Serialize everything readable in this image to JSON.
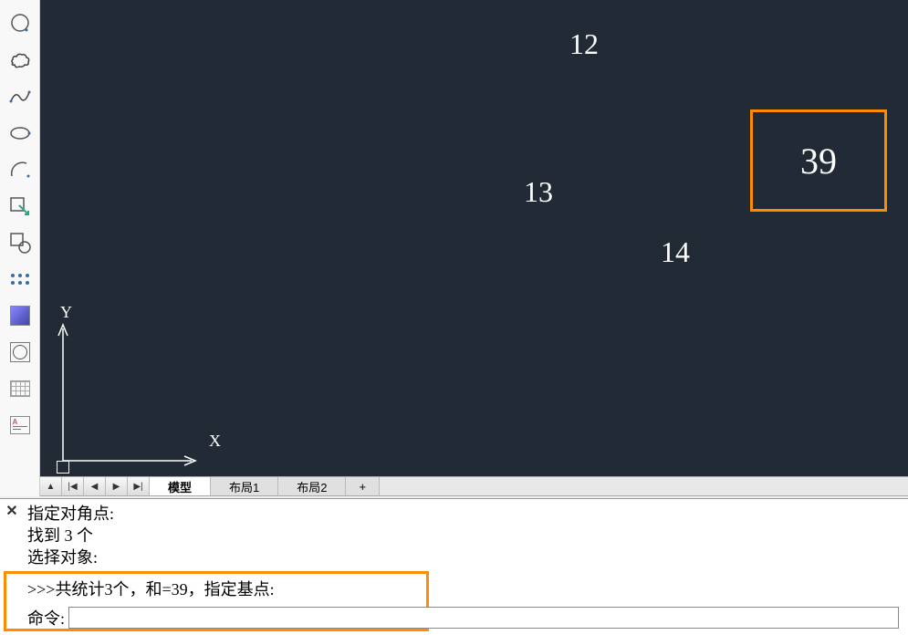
{
  "toolbar": {
    "items": [
      "circle-tool",
      "cloud-tool",
      "spline-tool",
      "ellipse-tool",
      "arc-tool",
      "block-insert-tool",
      "rect-circle-tool",
      "points-tool",
      "gradient-tool",
      "box-circle-tool",
      "grid-tool",
      "text-tool"
    ]
  },
  "canvas": {
    "numbers": {
      "n1": "12",
      "n2": "13",
      "n3": "14"
    },
    "highlight_value": "39",
    "ucs": {
      "x_label": "X",
      "y_label": "Y"
    }
  },
  "tabs": {
    "nav": {
      "first": "▲",
      "prev_all": "|◀",
      "prev": "◀",
      "next": "▶",
      "next_all": "▶|"
    },
    "items": [
      {
        "label": "模型",
        "active": true
      },
      {
        "label": "布局1",
        "active": false
      },
      {
        "label": "布局2",
        "active": false
      }
    ],
    "add_label": "+"
  },
  "command": {
    "close_label": "✕",
    "history": [
      "指定对角点:",
      "找到 3 个",
      "选择对象:"
    ],
    "sum_line": ">>>共统计3个，和=39，指定基点:",
    "prompt_label": "命令:",
    "input_value": ""
  }
}
